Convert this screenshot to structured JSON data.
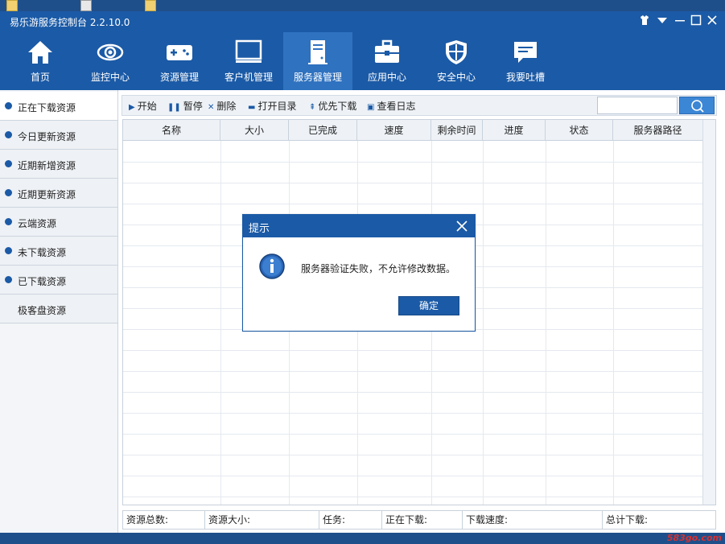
{
  "window": {
    "title": "易乐游服务控制台 2.2.10.0"
  },
  "nav": {
    "items": [
      {
        "label": "首页",
        "icon": "home-icon"
      },
      {
        "label": "监控中心",
        "icon": "eye-icon"
      },
      {
        "label": "资源管理",
        "icon": "gamepad-icon"
      },
      {
        "label": "客户机管理",
        "icon": "monitor-icon"
      },
      {
        "label": "服务器管理",
        "icon": "server-icon"
      },
      {
        "label": "应用中心",
        "icon": "toolbox-icon"
      },
      {
        "label": "安全中心",
        "icon": "shield-icon"
      },
      {
        "label": "我要吐槽",
        "icon": "chat-icon"
      }
    ],
    "active_index": 4
  },
  "sidebar": {
    "items": [
      {
        "label": "正在下载资源"
      },
      {
        "label": "今日更新资源"
      },
      {
        "label": "近期新增资源"
      },
      {
        "label": "近期更新资源"
      },
      {
        "label": "云端资源"
      },
      {
        "label": "未下载资源"
      },
      {
        "label": "已下载资源"
      },
      {
        "label": "极客盘资源"
      }
    ],
    "active_index": 0
  },
  "toolbar": {
    "start": "开始",
    "pause": "暂停",
    "delete": "删除",
    "open_dir": "打开目录",
    "priority": "优先下载",
    "view_log": "查看日志"
  },
  "search": {
    "value": "",
    "placeholder": ""
  },
  "table": {
    "columns": [
      "名称",
      "大小",
      "已完成",
      "速度",
      "剩余时间",
      "进度",
      "状态",
      "服务器路径"
    ],
    "rows": []
  },
  "status": {
    "total": "资源总数:",
    "size": "资源大小:",
    "tasks": "任务:",
    "downloading": "正在下载:",
    "speed": "下载速度:",
    "total_download": "总计下载:"
  },
  "dialog": {
    "title": "提示",
    "message": "服务器验证失败，不允许修改数据。",
    "ok_label": "确定",
    "icon": "info-icon"
  },
  "watermark": "583go.com",
  "colors": {
    "primary": "#1b5aa6",
    "nav_active": "#2f72c0",
    "search_button": "#3c86d6"
  }
}
